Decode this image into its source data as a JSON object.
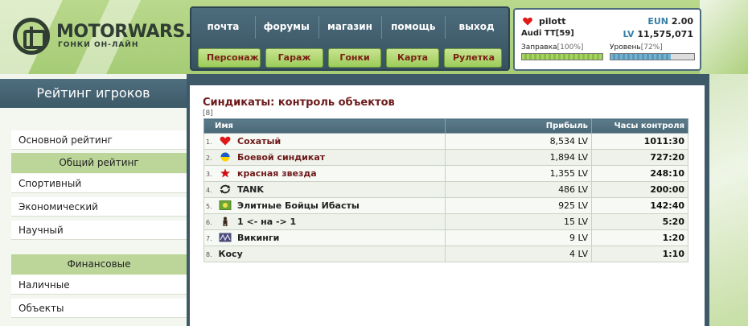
{
  "logo": {
    "title": "MOTORWARS.RU",
    "subtitle": "ГОНКИ ОН-ЛАЙН"
  },
  "top_links": [
    "почта",
    "форумы",
    "магазин",
    "помощь",
    "выход"
  ],
  "green_buttons": [
    "Персонаж",
    "Гараж",
    "Гонки",
    "Карта",
    "Рулетка"
  ],
  "user": {
    "name": "pilott",
    "car": "Audi TT[59]",
    "eun_label": "EUN",
    "eun_value": "2.00",
    "lv_label": "LV",
    "lv_value": "11,575,071",
    "fuel_label": "Заправка",
    "fuel_pct": "[100%]",
    "fuel_fraction": 1.0,
    "level_label": "Уровень",
    "level_pct": "[72%]",
    "level_fraction": 0.72
  },
  "sidebar": {
    "title": "Рейтинг игроков",
    "items": {
      "main_rating": "Основной рейтинг",
      "general_header": "Общий рейтинг",
      "sport": "Спортивный",
      "economic": "Экономический",
      "scientific": "Научный",
      "finance_header": "Финансовые",
      "cash": "Наличные",
      "objects": "Объекты"
    }
  },
  "main": {
    "title": "Синдикаты: контроль объектов",
    "count": "[8]",
    "columns": {
      "name": "Имя",
      "profit": "Прибыль",
      "hours": "Часы контроля"
    },
    "rows": [
      {
        "rank": "1.",
        "icon": "heart-icon",
        "name": "Сохатый",
        "profit": "8,534 LV",
        "hours": "1011:30"
      },
      {
        "rank": "2.",
        "icon": "ukraine-flag-icon",
        "name": "Боевой синдикат",
        "profit": "1,894 LV",
        "hours": "727:20"
      },
      {
        "rank": "3.",
        "icon": "red-star-icon",
        "name": "красная звезда",
        "profit": "1,355 LV",
        "hours": "248:10"
      },
      {
        "rank": "4.",
        "icon": "cycle-arrows-icon",
        "name": "TANK",
        "profit": "486 LV",
        "hours": "200:00"
      },
      {
        "rank": "5.",
        "icon": "green-flag-icon",
        "name": "Элитные Бойцы Ибасты",
        "profit": "925 LV",
        "hours": "142:40"
      },
      {
        "rank": "6.",
        "icon": "figure-icon",
        "name": "1 <- на -> 1",
        "profit": "15 LV",
        "hours": "5:20"
      },
      {
        "rank": "7.",
        "icon": "vikings-emblem-icon",
        "name": "Викинги",
        "profit": "9 LV",
        "hours": "1:20"
      },
      {
        "rank": "8.",
        "icon": "",
        "name": "Косу",
        "profit": "4 LV",
        "hours": "1:10"
      }
    ]
  },
  "colors": {
    "accent_dark_red": "#6d1a1a",
    "nav_blue": "#4d6c7c",
    "header_green": "#b9d88c",
    "fuel_bar": "#9ccc5a",
    "level_bar": "#6aa8c8"
  }
}
